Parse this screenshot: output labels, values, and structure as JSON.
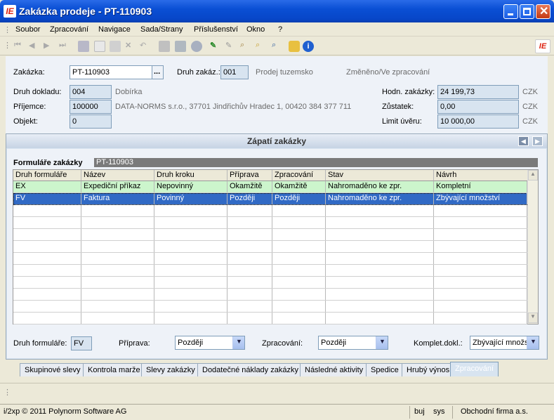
{
  "window": {
    "title": "Zakázka prodeje - PT-110903",
    "app_icon_text": "IE"
  },
  "menu": [
    "Soubor",
    "Zpracování",
    "Navigace",
    "Sada/Strany",
    "Příslušenství",
    "Okno",
    "?"
  ],
  "toolbar_icons": [
    "first-record-icon",
    "prev-record-icon",
    "next-record-icon",
    "last-record-icon",
    "save-icon",
    "new-icon",
    "copy-icon",
    "delete-icon",
    "undo-icon",
    "print-icon",
    "export-icon",
    "refresh-icon",
    "edit-icon",
    "erase-icon",
    "filter-icon",
    "search-icon",
    "find-icon",
    "lock-icon",
    "info-icon"
  ],
  "header": {
    "zakazka_label": "Zakázka:",
    "zakazka_value": "PT-110903",
    "browse_label": "...",
    "druh_zakazky_label": "Druh zakáz.:",
    "druh_zakazky_value": "001",
    "druh_zakazky_desc": "Prodej tuzemsko",
    "status_text": "Změněno/Ve zpracování",
    "druh_dokladu_label": "Druh dokladu:",
    "druh_dokladu_value": "004",
    "druh_dokladu_desc": "Dobírka",
    "prijemce_label": "Příjemce:",
    "prijemce_value": "100000",
    "prijemce_desc": "DATA-NORMS s.r.o., 37701 Jindřichův Hradec 1, 00420 384 377 711",
    "objekt_label": "Objekt:",
    "objekt_value": "0",
    "hodn_label": "Hodn. zakázky:",
    "hodn_value": "24 199,73",
    "zustatek_label": "Zůstatek:",
    "zustatek_value": "0,00",
    "limit_label": "Limit úvěru:",
    "limit_value": "10 000,00",
    "currency": "CZK"
  },
  "panel": {
    "title": "Zápatí zakázky",
    "forms_label": "Formuláře zakázky",
    "forms_value": "PT-110903"
  },
  "grid": {
    "columns": [
      "Druh formuláře",
      "Název",
      "Druh kroku",
      "Příprava",
      "Zpracování",
      "Stav",
      "Návrh"
    ],
    "rows": [
      [
        "EX",
        "Expediční příkaz",
        "Nepovinný",
        "Okamžitě",
        "Okamžitě",
        "Nahromaděno ke zpr.",
        "Kompletní"
      ],
      [
        "FV",
        "Faktura",
        "Povinný",
        "Později",
        "Později",
        "Nahromaděno ke zpr.",
        "Zbývající množství"
      ]
    ],
    "row_colors": [
      "#CCF5CC",
      "#316AC5"
    ]
  },
  "bottom_form": {
    "druh_formulare_label": "Druh formuláře:",
    "druh_formulare_value": "FV",
    "priprava_label": "Příprava:",
    "priprava_value": "Později",
    "zpracovani_label": "Zpracování:",
    "zpracovani_value": "Později",
    "komplet_label": "Komplet.dokl.:",
    "komplet_value": "Zbývající množs"
  },
  "tabs": [
    "Skupinové slevy",
    "Kontrola marže",
    "Slevy zakázky",
    "Dodatečné náklady zakázky",
    "Následné aktivity",
    "Spedice",
    "Hrubý výnos",
    "Zpracování"
  ],
  "active_tab": "Zpracování",
  "status": {
    "copyright": "i/2xp © 2011 Polynorm Software AG",
    "user": "buj",
    "system": "sys",
    "company": "Obchodní firma a.s."
  },
  "colors": {
    "title_bar": "#0A4FD4",
    "selection": "#316AC5",
    "green_row": "#CCF5CC",
    "panel": "#D8E4F0"
  }
}
